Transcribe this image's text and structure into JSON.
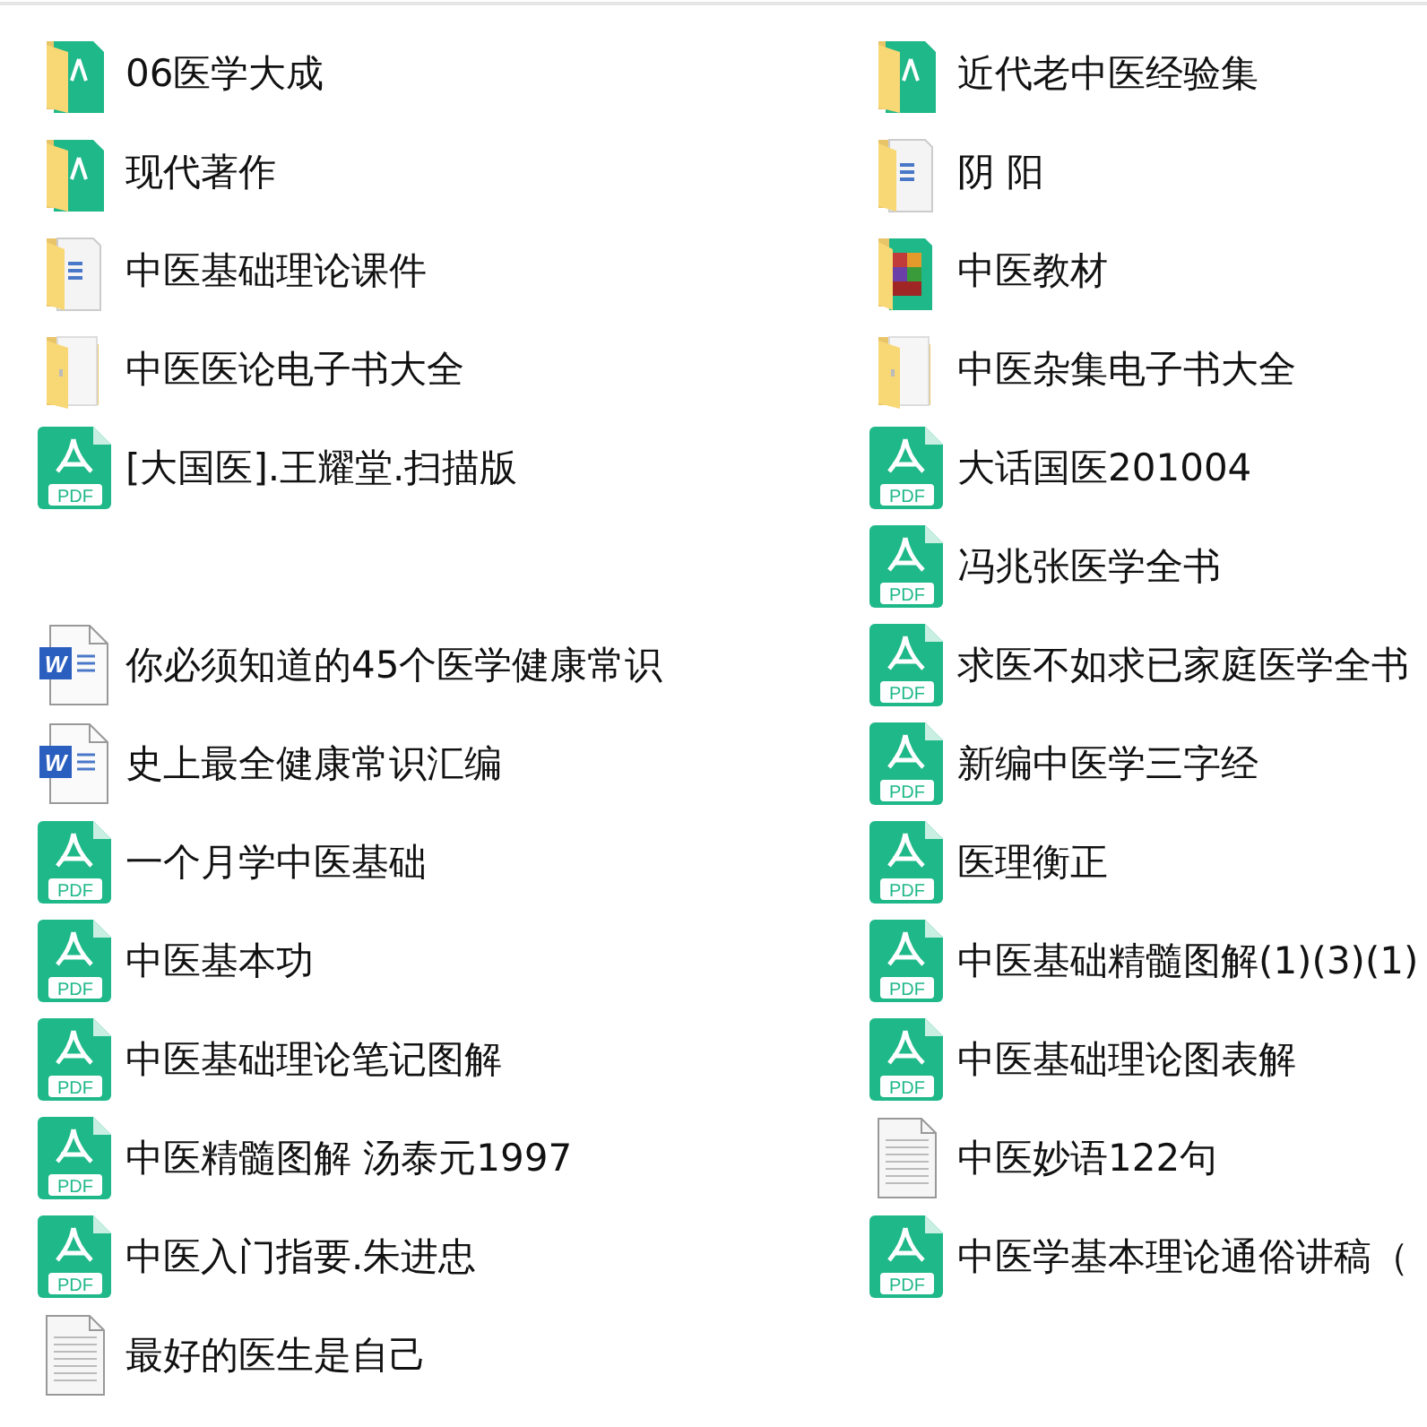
{
  "rows": [
    {
      "left": {
        "kind": "folder-pdf",
        "name": "06医学大成"
      },
      "right": {
        "kind": "folder-pdf",
        "name": "近代老中医经验集"
      }
    },
    {
      "left": {
        "kind": "folder-pdf",
        "name": "现代著作"
      },
      "right": {
        "kind": "folder-doc",
        "name": "阴 阳"
      }
    },
    {
      "left": {
        "kind": "folder-doc",
        "name": "中医基础理论课件"
      },
      "right": {
        "kind": "folder-color",
        "name": "中医教材"
      }
    },
    {
      "left": {
        "kind": "folder-plain",
        "name": "中医医论电子书大全"
      },
      "right": {
        "kind": "folder-plain",
        "name": "中医杂集电子书大全"
      }
    },
    {
      "left": {
        "kind": "pdf",
        "icon_text": "PDF",
        "name": "[大国医].王耀堂.扫描版"
      },
      "right": {
        "kind": "pdf",
        "icon_text": "PDF",
        "name": "大话国医201004"
      }
    },
    {
      "right": {
        "kind": "pdf",
        "icon_text": "PDF",
        "name": "冯兆张医学全书"
      }
    },
    {
      "left": {
        "kind": "word",
        "icon_text": "W",
        "name": "你必须知道的45个医学健康常识"
      },
      "right": {
        "kind": "pdf",
        "icon_text": "PDF",
        "name": "求医不如求已家庭医学全书"
      }
    },
    {
      "left": {
        "kind": "word",
        "icon_text": "W",
        "name": "史上最全健康常识汇编"
      },
      "right": {
        "kind": "pdf",
        "icon_text": "PDF",
        "name": "新编中医学三字经"
      }
    },
    {
      "left": {
        "kind": "pdf",
        "icon_text": "PDF",
        "name": "一个月学中医基础"
      },
      "right": {
        "kind": "pdf",
        "icon_text": "PDF",
        "name": "医理衡正"
      }
    },
    {
      "left": {
        "kind": "pdf",
        "icon_text": "PDF",
        "name": "中医基本功"
      },
      "right": {
        "kind": "pdf",
        "icon_text": "PDF",
        "name": "中医基础精髓图解(1)(3)(1)"
      }
    },
    {
      "left": {
        "kind": "pdf",
        "icon_text": "PDF",
        "name": "中医基础理论笔记图解"
      },
      "right": {
        "kind": "pdf",
        "icon_text": "PDF",
        "name": "中医基础理论图表解"
      }
    },
    {
      "left": {
        "kind": "pdf",
        "icon_text": "PDF",
        "name": "中医精髓图解 汤泰元1997"
      },
      "right": {
        "kind": "text",
        "name": "中医妙语122句"
      }
    },
    {
      "left": {
        "kind": "pdf",
        "icon_text": "PDF",
        "name": "中医入门指要.朱进忠"
      },
      "right": {
        "kind": "pdf",
        "icon_text": "PDF",
        "name": "中医学基本理论通俗讲稿（"
      }
    },
    {
      "left": {
        "kind": "text",
        "name": "最好的医生是自己"
      }
    }
  ]
}
